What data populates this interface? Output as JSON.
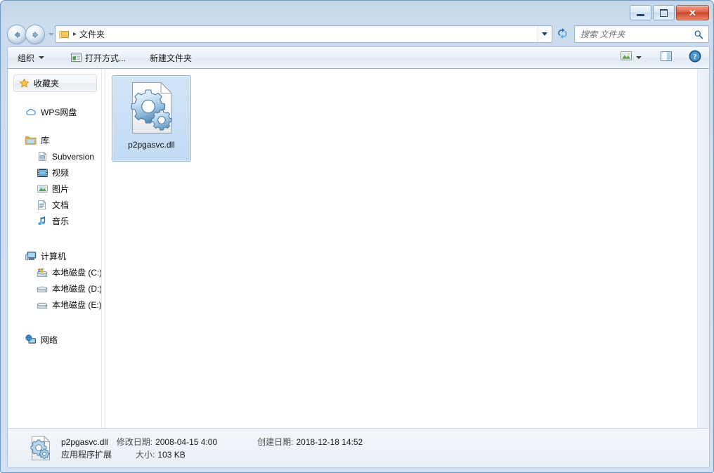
{
  "window": {
    "frame_color": "#c3d6e8",
    "buttons": {
      "minimize": "minimize",
      "maximize": "maximize",
      "close": "✕"
    }
  },
  "address_bar": {
    "crumb_separator": "▸",
    "path_label": "文件夹",
    "dropdown": "history-dropdown",
    "refresh": "refresh"
  },
  "search": {
    "placeholder": "搜索 文件夹",
    "value": ""
  },
  "command_bar": {
    "organize": "组织",
    "open_with": "打开方式...",
    "new_folder": "新建文件夹",
    "change_view": "change-view",
    "preview_pane": "preview-pane",
    "help": "help"
  },
  "nav_pane": {
    "favorites": {
      "label": "收藏夹",
      "icon": "star-icon"
    },
    "wps_cloud": {
      "label": "WPS网盘",
      "icon": "cloud-icon"
    },
    "libraries": {
      "label": "库",
      "icon": "library-folder-icon",
      "children": [
        {
          "label": "Subversion",
          "icon": "subversion-icon"
        },
        {
          "label": "视频",
          "icon": "videos-icon"
        },
        {
          "label": "图片",
          "icon": "pictures-icon"
        },
        {
          "label": "文档",
          "icon": "documents-icon"
        },
        {
          "label": "音乐",
          "icon": "music-icon"
        }
      ]
    },
    "computer": {
      "label": "计算机",
      "icon": "computer-icon",
      "children": [
        {
          "label": "本地磁盘 (C:)",
          "icon": "system-drive-icon"
        },
        {
          "label": "本地磁盘 (D:)",
          "icon": "drive-icon"
        },
        {
          "label": "本地磁盘 (E:)",
          "icon": "drive-icon"
        }
      ]
    },
    "network": {
      "label": "网络",
      "icon": "network-icon"
    }
  },
  "content": {
    "items": [
      {
        "name": "p2pgasvc.dll",
        "icon": "dll-gear-icon",
        "selected": true
      }
    ]
  },
  "status_bar": {
    "file_name": "p2pgasvc.dll",
    "modified_key": "修改日期:",
    "modified_value": "2008-04-15 4:00",
    "created_key": "创建日期:",
    "created_value": "2018-12-18 14:52",
    "file_type": "应用程序扩展",
    "size_key": "大小:",
    "size_value": "103 KB"
  }
}
